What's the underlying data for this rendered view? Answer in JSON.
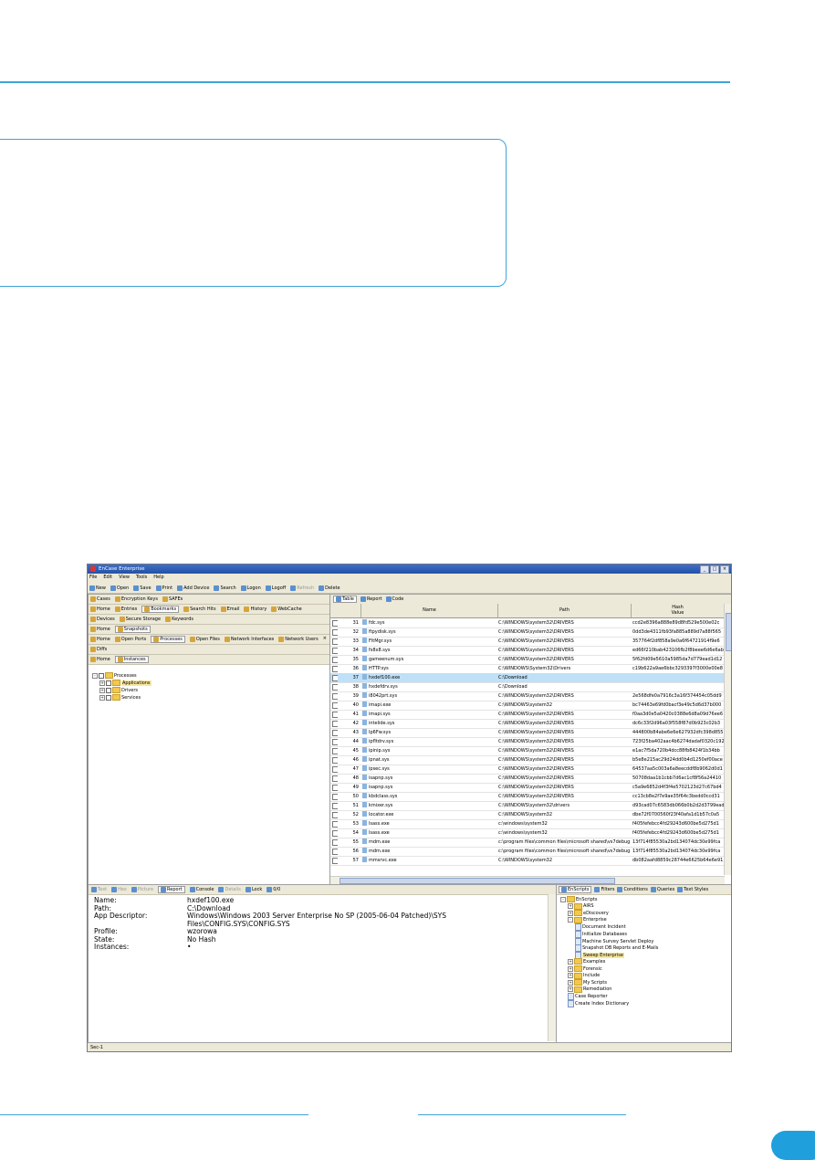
{
  "window": {
    "title": "EnCase Enterprise",
    "controls": [
      "_",
      "□",
      "×"
    ]
  },
  "menu": [
    "File",
    "Edit",
    "View",
    "Tools",
    "Help"
  ],
  "toolbar": [
    {
      "label": "New",
      "enabled": true
    },
    {
      "label": "Open",
      "enabled": true
    },
    {
      "label": "Save",
      "enabled": true
    },
    {
      "label": "Print",
      "enabled": true
    },
    {
      "label": "Add Device",
      "enabled": true
    },
    {
      "label": "Search",
      "enabled": true
    },
    {
      "label": "Logon",
      "enabled": true
    },
    {
      "label": "Logoff",
      "enabled": true
    },
    {
      "label": "Refresh",
      "enabled": false
    },
    {
      "label": "Delete",
      "enabled": true
    }
  ],
  "left_tabs": {
    "row1": [
      "Cases",
      "Encryption Keys",
      "SAFEs"
    ],
    "row2": [
      "Home",
      "Entries",
      "Bookmarks",
      "Search Hits",
      "Email",
      "History",
      "WebCache"
    ],
    "row3": [
      "Devices",
      "Secure Storage",
      "Keywords"
    ],
    "row4": [
      "Home",
      "Snapshots"
    ],
    "row5": [
      "Home",
      "Open Ports",
      "Processes",
      "Open Files",
      "Network Interfaces",
      "Network Users"
    ],
    "row6": [
      "Diffs"
    ],
    "row7": [
      "Home",
      "Instances"
    ],
    "close": "×"
  },
  "left_tree": [
    "Processes",
    "Applications",
    "Drivers",
    "Services"
  ],
  "right_tabs": [
    "Table",
    "Report",
    "Code"
  ],
  "table": {
    "headers": [
      "Name",
      "Path",
      "Hash\nValue"
    ],
    "rows": [
      {
        "n": "31",
        "name": "fdc.sys",
        "path": "C:\\WINDOWS\\system32\\DRIVERS",
        "hash": "ccd2e8396a888e89d8fd529e500e02c"
      },
      {
        "n": "32",
        "name": "ftpydisk.sys",
        "path": "C:\\WINDOWS\\system32\\DRIVERS",
        "hash": "0dd3de4311fb93fa885a889d7a88f565"
      },
      {
        "n": "33",
        "name": "FltMgr.sys",
        "path": "C:\\WINDOWS\\system32\\DRIVERS",
        "hash": "357764f2df858a9e0a6f64721914f9e6"
      },
      {
        "n": "34",
        "name": "fs8x8.sys",
        "path": "C:\\WINDOWS\\system32\\DRIVERS",
        "hash": "ed66f210bab423106fb2f8beee6d6e6ab"
      },
      {
        "n": "35",
        "name": "gameenum.sys",
        "path": "C:\\WINDOWS\\system32\\DRIVERS",
        "hash": "5f62fd09e5610a5985da7d779ead1d12"
      },
      {
        "n": "36",
        "name": "HTTP.sys",
        "path": "C:\\WINDOWS\\System32\\Drivers",
        "hash": "c19b622a9ae6bbc3293397f3000e00e8"
      },
      {
        "n": "37",
        "name": "hxdef100.exe",
        "path": "C:\\Download",
        "hash": "",
        "selected": true
      },
      {
        "n": "38",
        "name": "hxdefdrv.sys",
        "path": "C:\\Download",
        "hash": ""
      },
      {
        "n": "39",
        "name": "i8042prt.sys",
        "path": "C:\\WINDOWS\\system32\\DRIVERS",
        "hash": "2e568dfe0a7916c3a16f374454c05dd9"
      },
      {
        "n": "40",
        "name": "imapi.exe",
        "path": "C:\\WINDOWS\\system32",
        "hash": "bc74463e69fd0bacf3e49c5d6d37b000"
      },
      {
        "n": "41",
        "name": "imapi.sys",
        "path": "C:\\WINDOWS\\system32\\DRIVERS",
        "hash": "f0aa3d0e5a0420c0388e6d8a09d76ee6"
      },
      {
        "n": "42",
        "name": "intelide.sys",
        "path": "C:\\WINDOWS\\system32\\DRIVERS",
        "hash": "dc6c33f2d96a03f558f87d0b923c02b3"
      },
      {
        "n": "43",
        "name": "Ip6Fw.sys",
        "path": "C:\\WINDOWS\\system32\\DRIVERS",
        "hash": "444800b84abe6e6e627932dfc398d855"
      },
      {
        "n": "44",
        "name": "ipfltdrv.sys",
        "path": "C:\\WINDOWS\\system32\\DRIVERS",
        "hash": "723f25ba402aac4b6274dadaf0320c192"
      },
      {
        "n": "45",
        "name": "ipinip.sys",
        "path": "C:\\WINDOWS\\system32\\DRIVERS",
        "hash": "e1ac7f5da720b4dcc88fb8424f1b34bb"
      },
      {
        "n": "46",
        "name": "ipnat.sys",
        "path": "C:\\WINDOWS\\system32\\DRIVERS",
        "hash": "b5e8e215ac29d24dd0b4d1250ef00ace"
      },
      {
        "n": "47",
        "name": "ipsec.sys",
        "path": "C:\\WINDOWS\\system32\\DRIVERS",
        "hash": "64537aa5c003a6a8eecddf8b9062d0d1"
      },
      {
        "n": "48",
        "name": "isapnp.sys",
        "path": "C:\\WINDOWS\\system32\\DRIVERS",
        "hash": "50708daa1b1cbb7d6ac1cf8f56a24410"
      },
      {
        "n": "49",
        "name": "isapnp.sys",
        "path": "C:\\WINDOWS\\system32\\DRIVERS",
        "hash": "c5a9e6852d4f3f4e5702123d27c67bd4"
      },
      {
        "n": "50",
        "name": "kbdclass.sys",
        "path": "C:\\WINDOWS\\system32\\DRIVERS",
        "hash": "cc13cb8e2f7e9ae35f64c3bedd0ccd31"
      },
      {
        "n": "51",
        "name": "kmixer.sys",
        "path": "C:\\WINDOWS\\system32\\drivers",
        "hash": "d93cad07c6583db066b0b2d2d3799ead"
      },
      {
        "n": "52",
        "name": "locator.exe",
        "path": "C:\\WINDOWS\\system32",
        "hash": "dbe72f0700560f23f40afa1d1b57c0a5"
      },
      {
        "n": "53",
        "name": "lsass.exe",
        "path": "c:\\windows\\system32",
        "hash": "f405fefebcc4fd29243d600be5d275d1"
      },
      {
        "n": "54",
        "name": "lsass.exe",
        "path": "c:\\windows\\system32",
        "hash": "f405fefebcc4fd29243d600be5d275d1"
      },
      {
        "n": "55",
        "name": "mdm.exe",
        "path": "c:\\program files\\common files\\microsoft shared\\vs7debug",
        "hash": "13f714f85530a2bd134074dc30e99fca"
      },
      {
        "n": "56",
        "name": "mdm.exe",
        "path": "c:\\program files\\common files\\microsoft shared\\vs7debug",
        "hash": "13f714f85530a2bd134074dc30e99fca"
      },
      {
        "n": "57",
        "name": "mmsrvc.exe",
        "path": "C:\\WINDOWS\\system32",
        "hash": "db082aafd8859c28744e6625b64e6e91"
      }
    ]
  },
  "bottom_tabs": [
    {
      "label": "Text",
      "enabled": false
    },
    {
      "label": "Hex",
      "enabled": false
    },
    {
      "label": "Picture",
      "enabled": false
    },
    {
      "label": "Report",
      "enabled": true
    },
    {
      "label": "Console",
      "enabled": true
    },
    {
      "label": "Details",
      "enabled": false
    },
    {
      "label": "Lock",
      "enabled": true
    },
    {
      "label": "0/0",
      "enabled": true
    }
  ],
  "report": [
    {
      "k": "Name:",
      "v": "hxdef100.exe"
    },
    {
      "k": "Path:",
      "v": "C:\\Download"
    },
    {
      "k": "App Descriptor:",
      "v": "Windows\\Windows 2003 Server Enterprise No SP (2005-06-04 Patched)\\SYS"
    },
    {
      "k": "",
      "v": "Files\\CONFIG.SYS\\CONFIG.SYS"
    },
    {
      "k": "Profile:",
      "v": "wzorowa"
    },
    {
      "k": "State:",
      "v": "No Hash"
    },
    {
      "k": "Instances:",
      "v": "•"
    }
  ],
  "script_tabs": [
    "EnScripts",
    "Filters",
    "Conditions",
    "Queries",
    "Text Styles"
  ],
  "script_tree": [
    {
      "label": "EnScripts",
      "level": 0,
      "kind": "folder"
    },
    {
      "label": "AIRS",
      "level": 1,
      "kind": "folder"
    },
    {
      "label": "eDiscovery",
      "level": 1,
      "kind": "folder"
    },
    {
      "label": "Enterprise",
      "level": 1,
      "kind": "folder"
    },
    {
      "label": "Document Incident",
      "level": 2,
      "kind": "script"
    },
    {
      "label": "Initialize Databases",
      "level": 2,
      "kind": "script"
    },
    {
      "label": "Machine Survey Servlet Deploy",
      "level": 2,
      "kind": "script"
    },
    {
      "label": "Snapshot DB Reports and E-Mails",
      "level": 2,
      "kind": "script"
    },
    {
      "label": "Sweep Enterprise",
      "level": 2,
      "kind": "script",
      "selected": true
    },
    {
      "label": "Examples",
      "level": 1,
      "kind": "folder"
    },
    {
      "label": "Forensic",
      "level": 1,
      "kind": "folder"
    },
    {
      "label": "Include",
      "level": 1,
      "kind": "folder"
    },
    {
      "label": "My Scripts",
      "level": 1,
      "kind": "folder"
    },
    {
      "label": "Remediation",
      "level": 1,
      "kind": "folder"
    },
    {
      "label": "Case Reporter",
      "level": 1,
      "kind": "script"
    },
    {
      "label": "Create Index Dictionary",
      "level": 1,
      "kind": "script"
    }
  ],
  "status": "Sec-1",
  "colors": {
    "accent": "#3fa3d8",
    "badge": "#1f9fdc",
    "selection": "#bfe0f7"
  }
}
